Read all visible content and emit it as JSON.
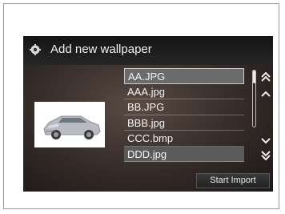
{
  "window": {
    "title": "Add new wallpaper",
    "icon": "gear-icon"
  },
  "files": [
    {
      "name": "AA.JPG",
      "state": "selected"
    },
    {
      "name": "AAA.jpg",
      "state": "normal"
    },
    {
      "name": "BB.JPG",
      "state": "normal"
    },
    {
      "name": "BBB.jpg",
      "state": "normal"
    },
    {
      "name": "CCC.bmp",
      "state": "normal"
    },
    {
      "name": "DDD.jpg",
      "state": "highlighted"
    }
  ],
  "controls": {
    "page_up": "double-chevron-up-icon",
    "scroll_up": "chevron-up-icon",
    "scroll_down": "chevron-down-icon",
    "page_down": "double-chevron-down-icon",
    "start_import_label": "Start Import"
  },
  "preview": {
    "icon": "car-icon"
  }
}
